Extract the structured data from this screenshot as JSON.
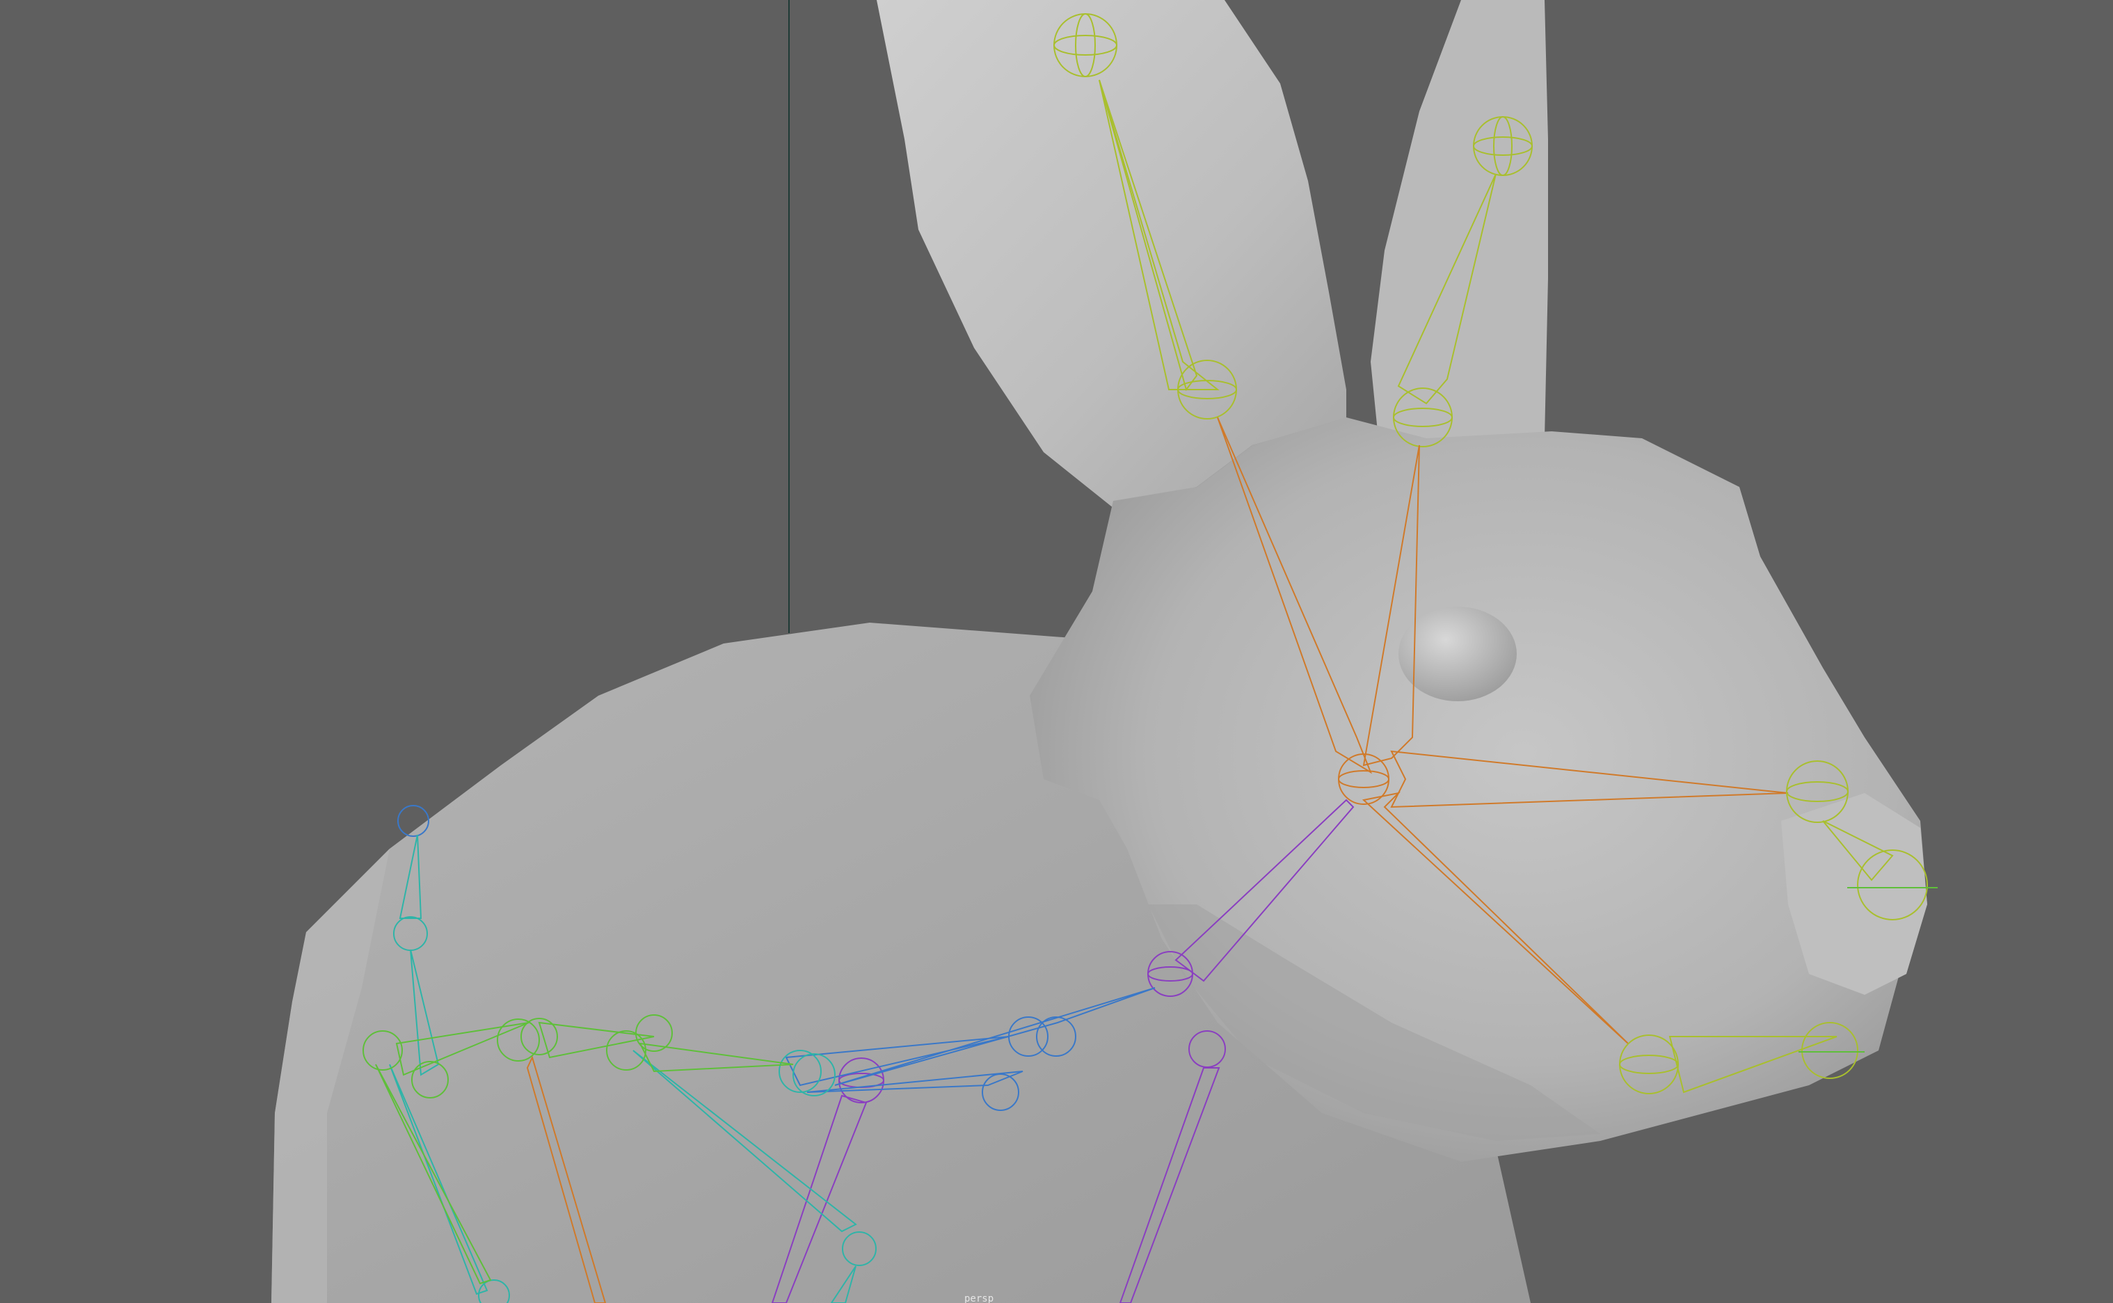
{
  "viewport": {
    "background_color": "#5f5f5f",
    "mesh_name": "bunny-mesh",
    "bottom_label": "persp"
  },
  "colors": {
    "mesh_light": "#c2c2c2",
    "mesh_mid": "#a8a8a8",
    "mesh_shadow": "#8c8c8c",
    "joint_yellow_green": "#a9bf2e",
    "joint_orange": "#d07a2a",
    "joint_purple": "#8a3fc0",
    "joint_teal": "#2fb4a8",
    "joint_blue": "#3a78c8",
    "joint_green": "#5fbf3a",
    "axis_line": "#1f3a36"
  },
  "skeleton": {
    "chains": [
      "left-ear-chain",
      "right-ear-chain",
      "head-chain",
      "nose-chain",
      "jaw-chain",
      "neck-chain",
      "spine-chain",
      "tail-chain",
      "front-leg-chain",
      "back-leg-chain"
    ]
  }
}
